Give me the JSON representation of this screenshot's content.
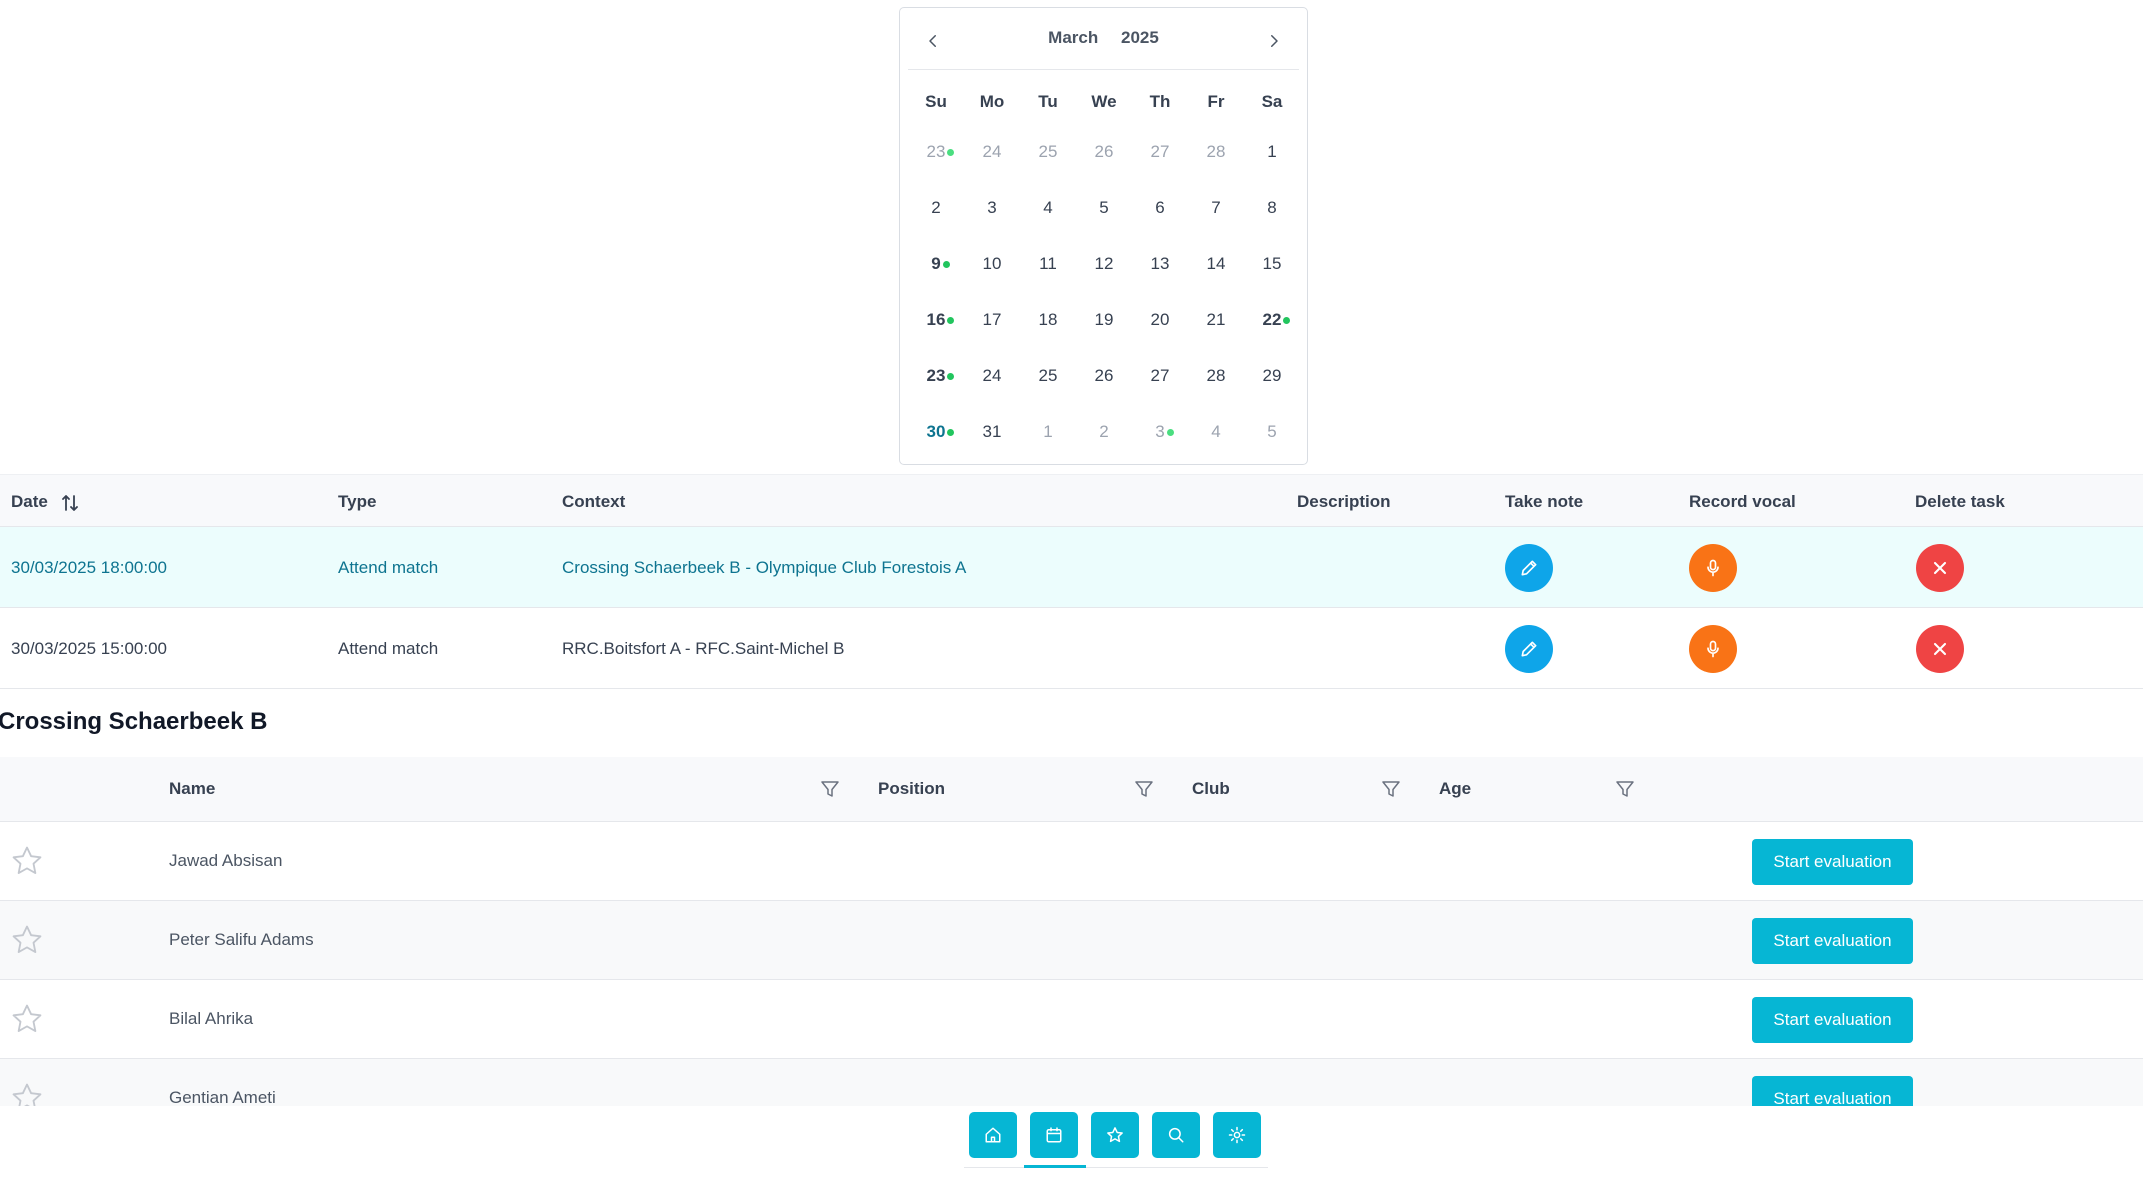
{
  "calendar": {
    "month": "March",
    "year": "2025",
    "weekdays": [
      "Su",
      "Mo",
      "Tu",
      "We",
      "Th",
      "Fr",
      "Sa"
    ],
    "days": [
      {
        "label": "23",
        "muted": true,
        "dot": true
      },
      {
        "label": "24",
        "muted": true
      },
      {
        "label": "25",
        "muted": true
      },
      {
        "label": "26",
        "muted": true
      },
      {
        "label": "27",
        "muted": true
      },
      {
        "label": "28",
        "muted": true
      },
      {
        "label": "1"
      },
      {
        "label": "2"
      },
      {
        "label": "3"
      },
      {
        "label": "4"
      },
      {
        "label": "5"
      },
      {
        "label": "6"
      },
      {
        "label": "7"
      },
      {
        "label": "8"
      },
      {
        "label": "9",
        "bold": true,
        "dot": true
      },
      {
        "label": "10"
      },
      {
        "label": "11"
      },
      {
        "label": "12"
      },
      {
        "label": "13"
      },
      {
        "label": "14"
      },
      {
        "label": "15"
      },
      {
        "label": "16",
        "bold": true,
        "dot": true
      },
      {
        "label": "17"
      },
      {
        "label": "18"
      },
      {
        "label": "19"
      },
      {
        "label": "20"
      },
      {
        "label": "21"
      },
      {
        "label": "22",
        "bold": true,
        "dot": true
      },
      {
        "label": "23",
        "bold": true,
        "dot": true
      },
      {
        "label": "24"
      },
      {
        "label": "25"
      },
      {
        "label": "26"
      },
      {
        "label": "27"
      },
      {
        "label": "28"
      },
      {
        "label": "29"
      },
      {
        "label": "30",
        "today": true,
        "dot": true
      },
      {
        "label": "31"
      },
      {
        "label": "1",
        "muted": true
      },
      {
        "label": "2",
        "muted": true
      },
      {
        "label": "3",
        "muted": true,
        "dot": true
      },
      {
        "label": "4",
        "muted": true
      },
      {
        "label": "5",
        "muted": true
      }
    ]
  },
  "tasks": {
    "headers": {
      "date": "Date",
      "type": "Type",
      "context": "Context",
      "description": "Description",
      "take_note": "Take note",
      "record_vocal": "Record vocal",
      "delete_task": "Delete task"
    },
    "rows": [
      {
        "date": "30/03/2025 18:00:00",
        "type": "Attend match",
        "context": "Crossing Schaerbeek B - Olympique Club Forestois A",
        "description": "",
        "active": true
      },
      {
        "date": "30/03/2025 15:00:00",
        "type": "Attend match",
        "context": "RRC.Boitsfort A - RFC.Saint-Michel B",
        "description": "",
        "active": false
      }
    ]
  },
  "team": {
    "title": "Crossing Schaerbeek B",
    "headers": {
      "name": "Name",
      "position": "Position",
      "club": "Club",
      "age": "Age"
    },
    "eval_label": "Start evaluation",
    "players": [
      {
        "name": "Jawad Absisan"
      },
      {
        "name": "Peter Salifu Adams"
      },
      {
        "name": "Bilal Ahrika"
      },
      {
        "name": "Gentian Ameti"
      }
    ]
  },
  "nav": {
    "items": [
      "home-icon",
      "calendar-icon",
      "star-icon",
      "search-icon",
      "settings-icon"
    ],
    "active": "calendar-icon"
  },
  "colors": {
    "accent": "#06b6d4",
    "note_button": "#0ea5e9",
    "vocal_button": "#f97316",
    "delete_button": "#ef4444",
    "event_dot": "#22c55e",
    "active_row_bg": "#ecfdfd",
    "active_text": "#0e7490"
  }
}
